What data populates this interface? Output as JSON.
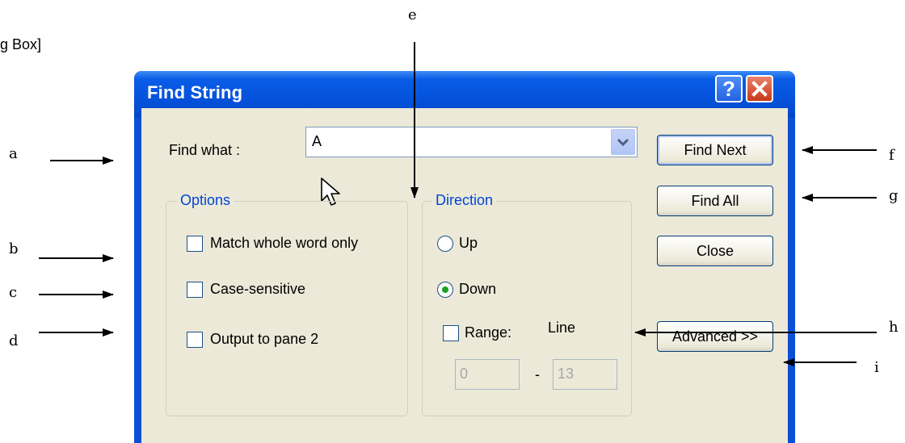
{
  "caption_fragment": "g Box]",
  "dialog": {
    "title": "Find String",
    "help_glyph": "?",
    "close_glyph": "×",
    "find_what_label": "Find what :",
    "find_what_value": "A",
    "options": {
      "title": "Options",
      "match_whole_word": "Match whole word only",
      "case_sensitive": "Case-sensitive",
      "output_to_pane2": "Output to pane 2"
    },
    "direction": {
      "title": "Direction",
      "up": "Up",
      "down": "Down",
      "selected": "Down",
      "range_label": "Range:",
      "line_label": "Line",
      "range_from": "0",
      "range_sep": "-",
      "range_to": "13"
    },
    "buttons": {
      "find_next": "Find Next",
      "find_all": "Find All",
      "close": "Close",
      "advanced": "Advanced >>"
    }
  },
  "callouts": [
    "a",
    "b",
    "c",
    "d",
    "e",
    "f",
    "g",
    "h",
    "i"
  ],
  "colors": {
    "titlebar": "#0553dd",
    "client_bg": "#ece9d8",
    "group_title": "#0046d5",
    "radio_dot": "#21a121",
    "close_button": "#c7391a"
  },
  "icons": [
    "help-icon",
    "close-icon",
    "chevron-down-icon",
    "mouse-pointer-icon"
  ]
}
